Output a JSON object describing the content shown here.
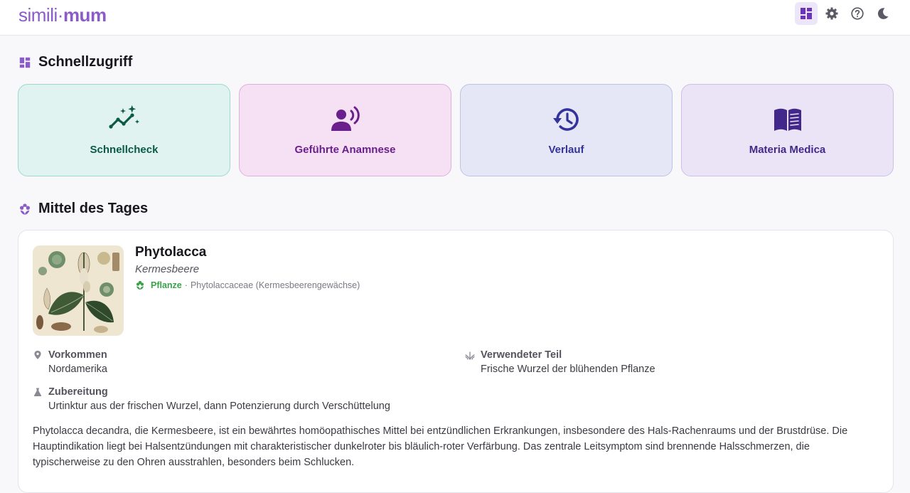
{
  "app": {
    "logo_left": "simili",
    "logo_dot": "·",
    "logo_right": "mum"
  },
  "header": {
    "icons": [
      "dashboard-icon",
      "gear-icon",
      "help-icon",
      "moon-icon"
    ]
  },
  "quick_access": {
    "title": "Schnellzugriff",
    "tiles": [
      {
        "label": "Schnellcheck",
        "icon": "sparkle-trend-icon"
      },
      {
        "label": "Geführte Anamnese",
        "icon": "person-voice-icon"
      },
      {
        "label": "Verlauf",
        "icon": "history-icon"
      },
      {
        "label": "Materia Medica",
        "icon": "book-icon"
      }
    ]
  },
  "remedy_of_day": {
    "title": "Mittel des Tages",
    "name": "Phytolacca",
    "common_name": "Kermesbeere",
    "kingdom": "Pflanze",
    "separator": "·",
    "family": "Phytolaccaceae (Kermesbeerengewächse)",
    "occurrence_label": "Vorkommen",
    "occurrence_value": "Nordamerika",
    "part_label": "Verwendeter Teil",
    "part_value": "Frische Wurzel der blühenden Pflanze",
    "preparation_label": "Zubereitung",
    "preparation_value": "Urtinktur aus der frischen Wurzel, dann Potenzierung durch Verschüttelung",
    "description": "Phytolacca decandra, die Kermesbeere, ist ein bewährtes homöopathisches Mittel bei entzündlichen Erkrankungen, insbesondere des Hals-Rachenraums und der Brustdrüse. Die Hauptindikation liegt bei Halsentzündungen mit charakteristischer dunkelroter bis bläulich-roter Verfärbung. Das zentrale Leitsymptom sind brennende Halsschmerzen, die typischerweise zu den Ohren ausstrahlen, besonders beim Schlucken."
  },
  "colors": {
    "brand": "#8b5cc9",
    "plant_green": "#3aa14a"
  }
}
